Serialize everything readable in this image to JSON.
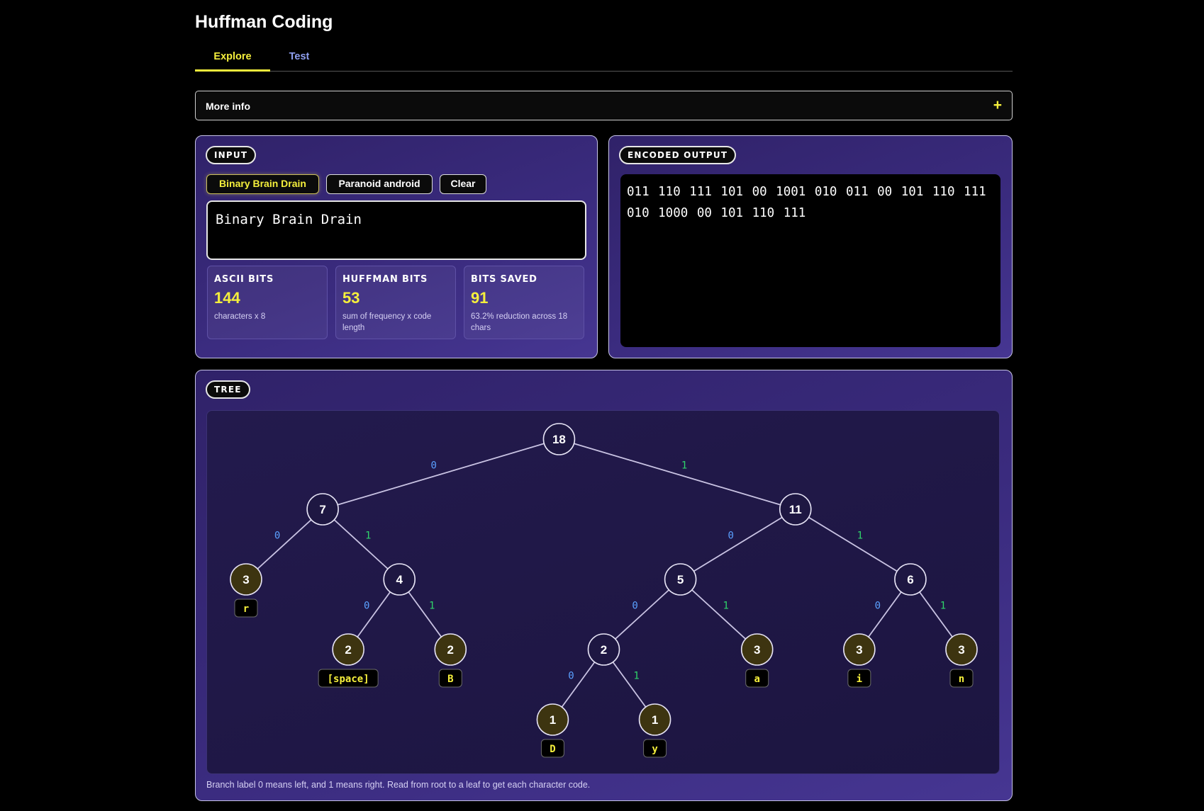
{
  "app": {
    "title": "Huffman Coding"
  },
  "tabs": [
    {
      "label": "Explore",
      "active": true
    },
    {
      "label": "Test",
      "active": false
    }
  ],
  "more_info": {
    "label": "More info",
    "toggle_icon": "+"
  },
  "input_panel": {
    "title": "INPUT",
    "presets": [
      {
        "label": "Binary Brain Drain",
        "active": true
      },
      {
        "label": "Paranoid android",
        "active": false
      },
      {
        "label": "Clear",
        "active": false
      }
    ],
    "text_value": "Binary Brain Drain",
    "stats": [
      {
        "label": "ASCII BITS",
        "value": "144",
        "sub": "characters x 8"
      },
      {
        "label": "HUFFMAN BITS",
        "value": "53",
        "sub": "sum of frequency x code length"
      },
      {
        "label": "BITS SAVED",
        "value": "91",
        "sub": "63.2% reduction across 18 chars"
      }
    ]
  },
  "output_panel": {
    "title": "ENCODED OUTPUT",
    "encoded": "011 110 111 101 00 1001 010 011 00 101 110 111 010 1000 00 101 110 111"
  },
  "tree_panel": {
    "title": "TREE",
    "caption": "Branch label 0 means left, and 1 means right. Read from root to a leaf to get each character code.",
    "root": {
      "w": "18",
      "children": [
        {
          "w": "7",
          "children": [
            {
              "w": "3",
              "char": "r"
            },
            {
              "w": "4",
              "children": [
                {
                  "w": "2",
                  "char": "[space]"
                },
                {
                  "w": "2",
                  "char": "B"
                }
              ]
            }
          ]
        },
        {
          "w": "11",
          "children": [
            {
              "w": "5",
              "children": [
                {
                  "w": "2",
                  "children": [
                    {
                      "w": "1",
                      "char": "D"
                    },
                    {
                      "w": "1",
                      "char": "y"
                    }
                  ]
                },
                {
                  "w": "3",
                  "char": "a"
                }
              ]
            },
            {
              "w": "6",
              "children": [
                {
                  "w": "3",
                  "char": "i"
                },
                {
                  "w": "3",
                  "char": "n"
                }
              ]
            }
          ]
        }
      ]
    }
  },
  "colors": {
    "accent": "#f5ef3c",
    "panel": "#3a2b7e",
    "bit_zero": "#5aa0ff",
    "bit_one": "#2fd36a",
    "leaf_fill": "#3d3410",
    "internal_fill": "#1e1742"
  }
}
